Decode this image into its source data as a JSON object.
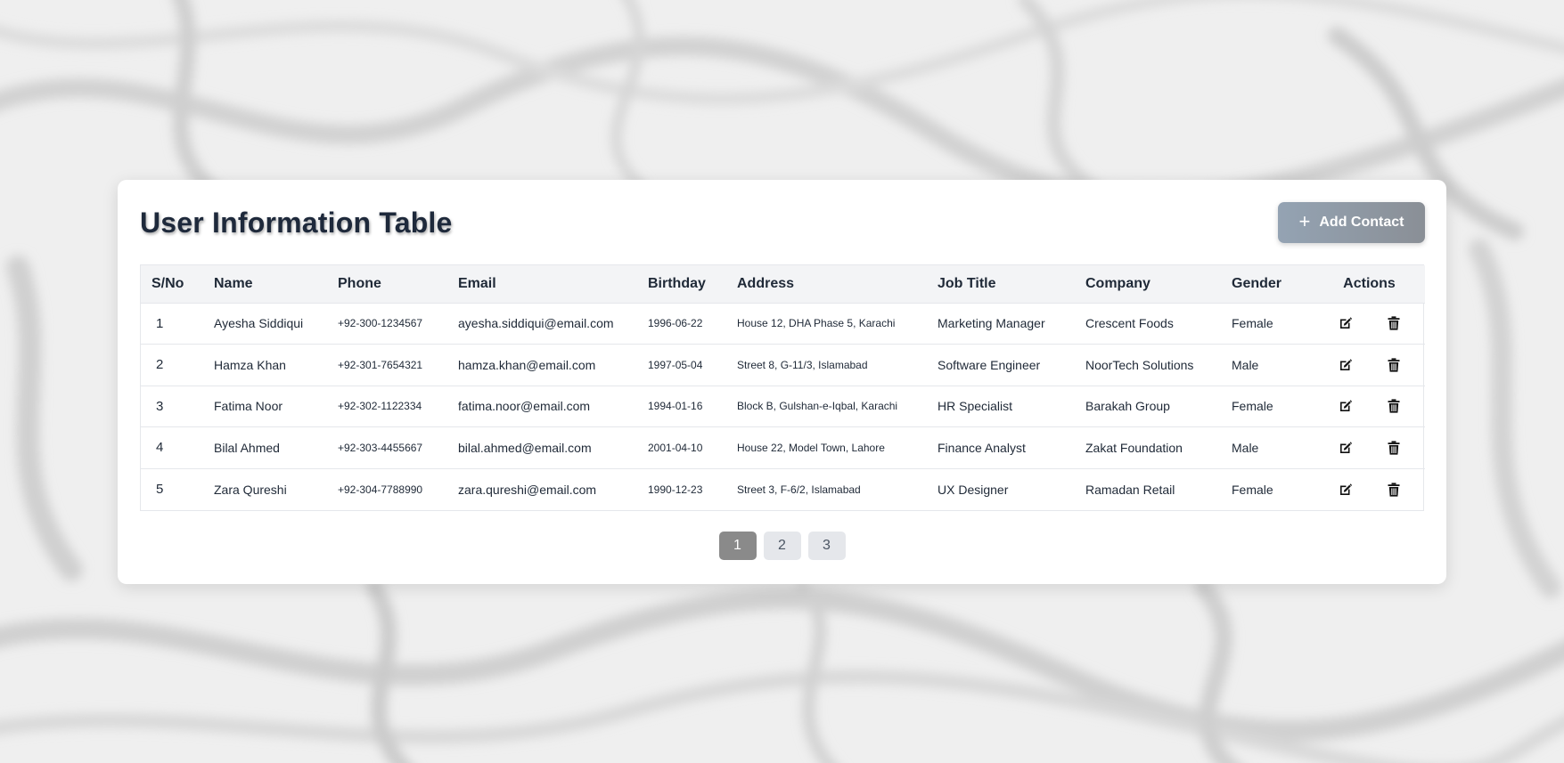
{
  "page": {
    "title": "User Information Table",
    "add_button_label": "Add Contact"
  },
  "table": {
    "columns": [
      "S/No",
      "Name",
      "Phone",
      "Email",
      "Birthday",
      "Address",
      "Job Title",
      "Company",
      "Gender",
      "Actions"
    ],
    "rows": [
      [
        "1",
        "Ayesha Siddiqui",
        "+92-300-1234567",
        "ayesha.siddiqui@email.com",
        "1996-06-22",
        "House 12, DHA Phase 5, Karachi",
        "Marketing Manager",
        "Crescent Foods",
        "Female"
      ],
      [
        "2",
        "Hamza Khan",
        "+92-301-7654321",
        "hamza.khan@email.com",
        "1997-05-04",
        "Street 8, G-11/3, Islamabad",
        "Software Engineer",
        "NoorTech Solutions",
        "Male"
      ],
      [
        "3",
        "Fatima Noor",
        "+92-302-1122334",
        "fatima.noor@email.com",
        "1994-01-16",
        "Block B, Gulshan-e-Iqbal, Karachi",
        "HR Specialist",
        "Barakah Group",
        "Female"
      ],
      [
        "4",
        "Bilal Ahmed",
        "+92-303-4455667",
        "bilal.ahmed@email.com",
        "2001-04-10",
        "House 22, Model Town, Lahore",
        "Finance Analyst",
        "Zakat Foundation",
        "Male"
      ],
      [
        "5",
        "Zara Qureshi",
        "+92-304-7788990",
        "zara.qureshi@email.com",
        "1990-12-23",
        "Street 3, F-6/2, Islamabad",
        "UX Designer",
        "Ramadan Retail",
        "Female"
      ]
    ],
    "row_actions": [
      "edit-icon",
      "trash-icon"
    ]
  },
  "pagination": {
    "pages": [
      "1",
      "2",
      "3"
    ],
    "current": "1"
  },
  "colors": {
    "button_gradient_start": "#94a3b3",
    "button_gradient_end": "#8a8f96",
    "active_page": "#8a8a8a",
    "header_bg": "#f3f4f6"
  }
}
